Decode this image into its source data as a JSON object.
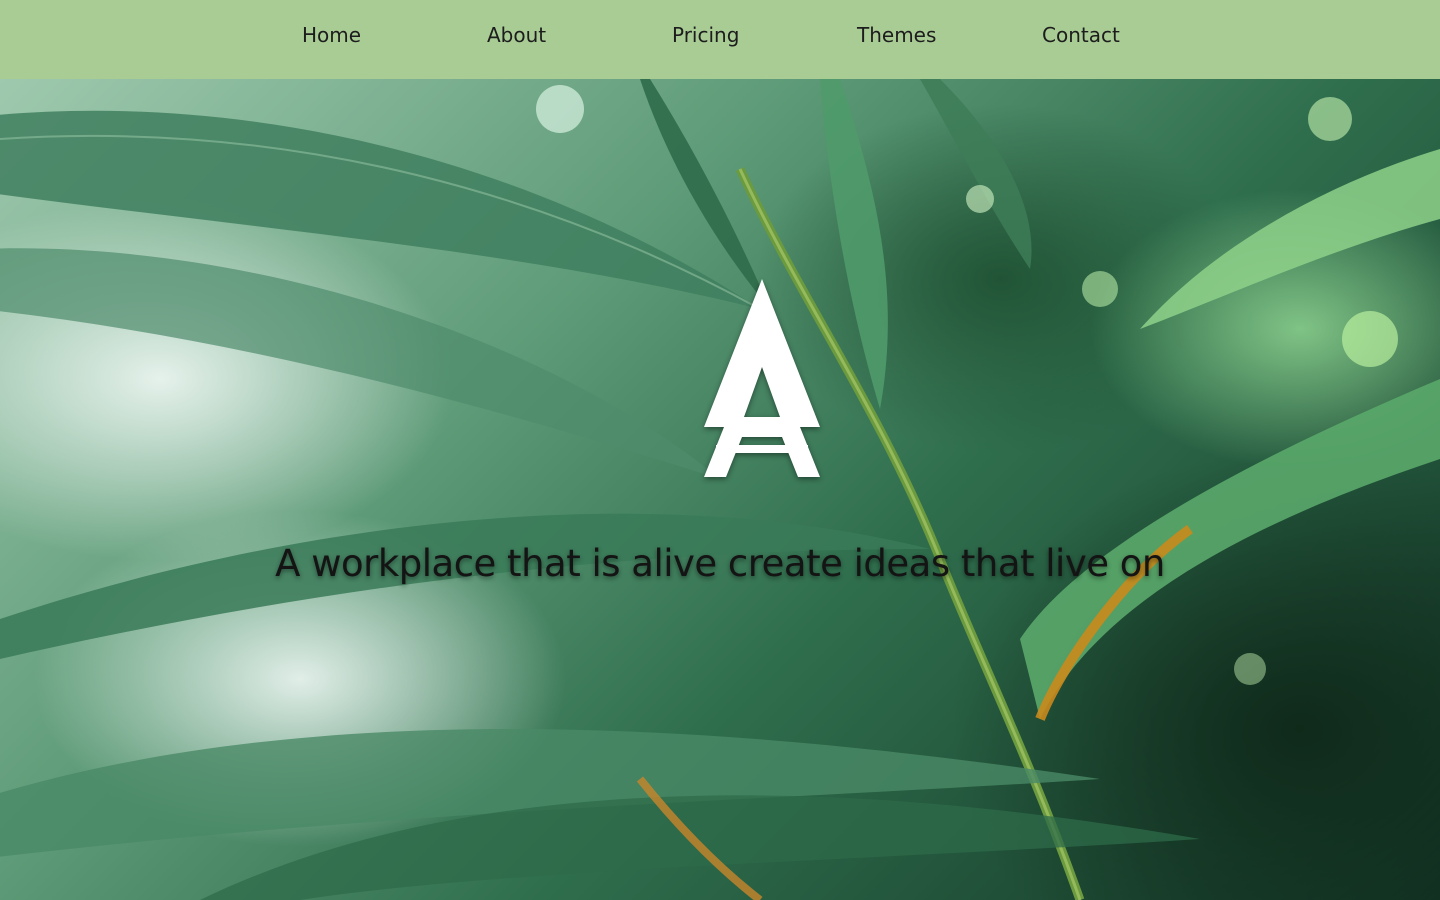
{
  "nav": {
    "items": [
      {
        "label": "Home"
      },
      {
        "label": "About"
      },
      {
        "label": "Pricing"
      },
      {
        "label": "Themes"
      },
      {
        "label": "Contact"
      }
    ],
    "background_color": "#a8cc94"
  },
  "hero": {
    "logo_icon": "triangle-a-logo-icon",
    "tagline": "A workplace that is alive create ideas that live on",
    "background": "bamboo-leaves-photo"
  }
}
